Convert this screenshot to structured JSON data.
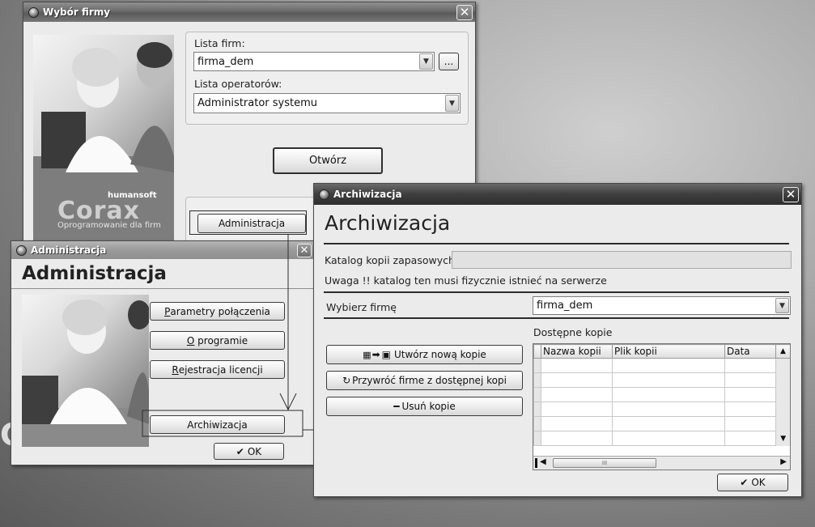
{
  "wybor": {
    "title": "Wybór firmy",
    "lista_firm_label": "Lista firm:",
    "lista_firm_value": "firma_dem",
    "browse_label": "...",
    "operator_label": "Lista operatorów:",
    "operator_value": "Administrator systemu",
    "open_label": "Otwórz",
    "admin_label": "Administracja",
    "brand_company": "humansoft",
    "brand_name": "Corax",
    "brand_tagline": "Oprogramowanie dla firm"
  },
  "admin": {
    "title": "Administracja",
    "heading": "Administracja",
    "buttons": {
      "param_first": "P",
      "param_rest": "arametry połączenia",
      "about_first": "O",
      "about_rest": " programie",
      "reg_first": "R",
      "reg_rest": "ejestracja licencji",
      "archive": "Archiwizacja"
    },
    "ok_label": "OK"
  },
  "arch": {
    "title": "Archiwizacja",
    "heading": "Archiwizacja",
    "katalog_label": "Katalog kopii zapasowych",
    "katalog_value": "",
    "warning": "Uwaga !! katalog ten musi fizycznie istnieć na serwerze",
    "firm_label": "Wybierz firmę",
    "firm_value": "firma_dem",
    "available_label": "Dostępne kopie",
    "create_label": "Utwórz nową kopie",
    "restore_label": "Przywróć firme z dostępnej kopi",
    "delete_label": "Usuń kopie",
    "columns": [
      "Nazwa kopii",
      "Plik kopii",
      "Data"
    ],
    "ok_label": "OK",
    "scroll_grip": "III"
  },
  "colors": {
    "titlebar": "#6b6b6b",
    "window": "#ebebeb",
    "desktop": "#a9a9a9"
  }
}
